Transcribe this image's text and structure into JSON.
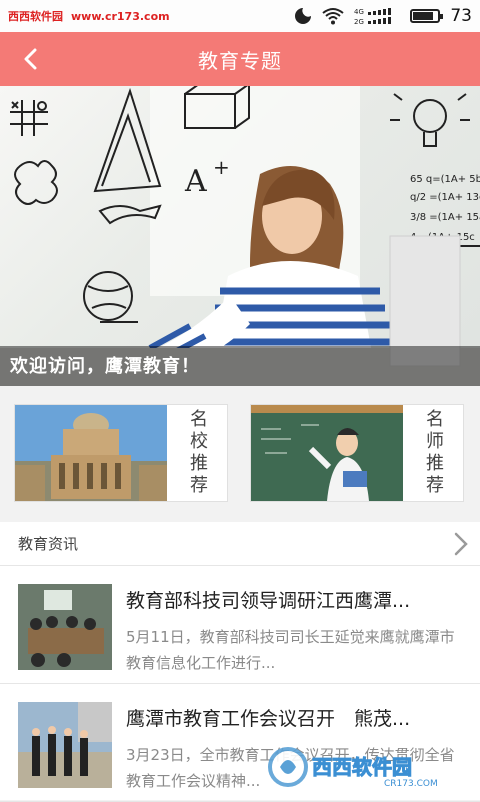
{
  "status_bar": {
    "watermark": "西西软件园",
    "url": "www.cr173.com",
    "network_top": "4G",
    "network_bottom": "2G",
    "battery_level": 0.8,
    "battery": "73"
  },
  "header": {
    "title": "教育专题"
  },
  "banner": {
    "caption": "欢迎访问，鹰潭教育！"
  },
  "recommend": [
    {
      "label": "名校推荐"
    },
    {
      "label": "名师推荐"
    }
  ],
  "news_section": {
    "title": "教育资讯"
  },
  "news": [
    {
      "title": "教育部科技司领导调研江西鹰潭...",
      "summary": "5月11日，教育部科技司司长王延觉来鹰就鹰潭市教育信息化工作进行..."
    },
    {
      "title": "鹰潭市教育工作会议召开　熊茂...",
      "summary": "3月23日，全市教育工作会议召开，传达贯彻全省教育工作会议精神..."
    }
  ],
  "watermark": {
    "brand": "西西软件园",
    "url": "CR173.COM"
  },
  "colors": {
    "accent": "#f47a76"
  }
}
